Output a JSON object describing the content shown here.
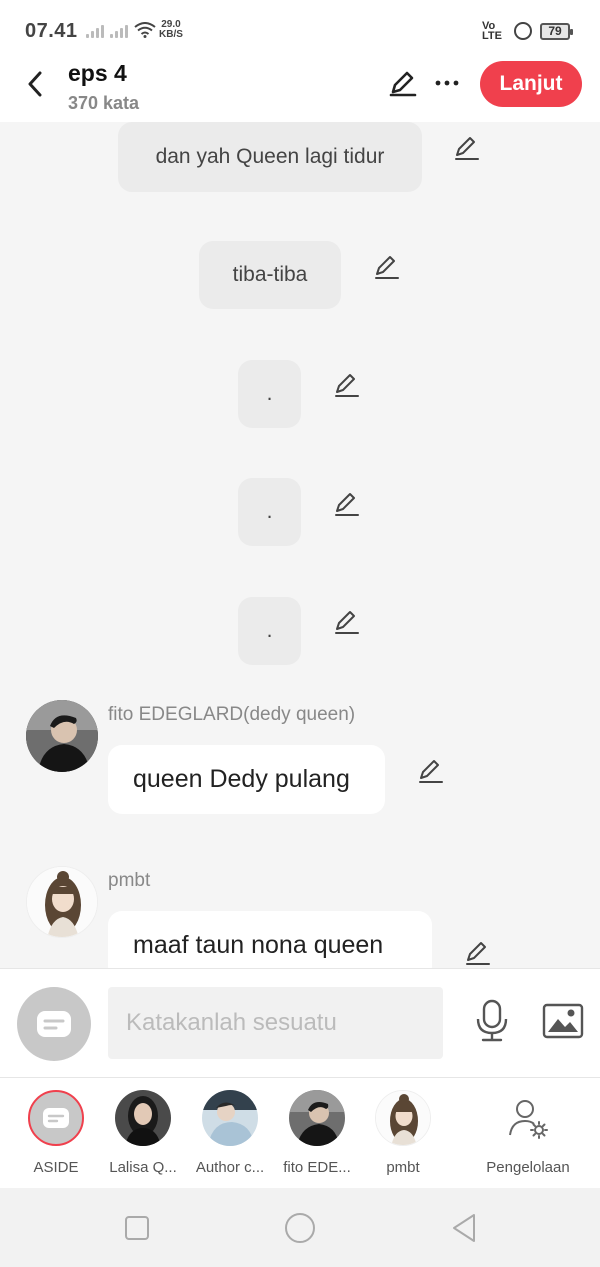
{
  "status_bar": {
    "time": "07.41",
    "net_speed_value": "29.0",
    "net_speed_unit": "KB/S",
    "volte_top": "Vo",
    "volte_bottom": "LTE",
    "battery": "79"
  },
  "header": {
    "title": "eps 4",
    "subtitle": "370 kata",
    "next_label": "Lanjut"
  },
  "chat": {
    "narrations": [
      {
        "text": "dan yah Queen lagi tidur"
      },
      {
        "text": "tiba-tiba"
      },
      {
        "text": "."
      },
      {
        "text": "."
      },
      {
        "text": "."
      }
    ],
    "messages": [
      {
        "speaker": "fito EDEGLARD(dedy queen)",
        "text": "queen Dedy pulang"
      },
      {
        "speaker": "pmbt",
        "text": "maaf taun nona queen"
      }
    ]
  },
  "composer": {
    "placeholder": "Katakanlah sesuatu"
  },
  "characters": [
    {
      "label": "ASIDE"
    },
    {
      "label": "Lalisa Q..."
    },
    {
      "label": "Author c..."
    },
    {
      "label": "fito EDE..."
    },
    {
      "label": "pmbt"
    },
    {
      "label": "Pengelolaan"
    }
  ],
  "icons": {
    "back": "chevron-left-icon",
    "edit": "pencil-icon",
    "more": "more-horizontal-icon",
    "mic": "microphone-icon",
    "image": "image-icon",
    "manage": "user-settings-icon"
  },
  "colors": {
    "accent": "#f0404d",
    "narration_bg": "#ebebeb",
    "background": "#f5f5f5"
  }
}
